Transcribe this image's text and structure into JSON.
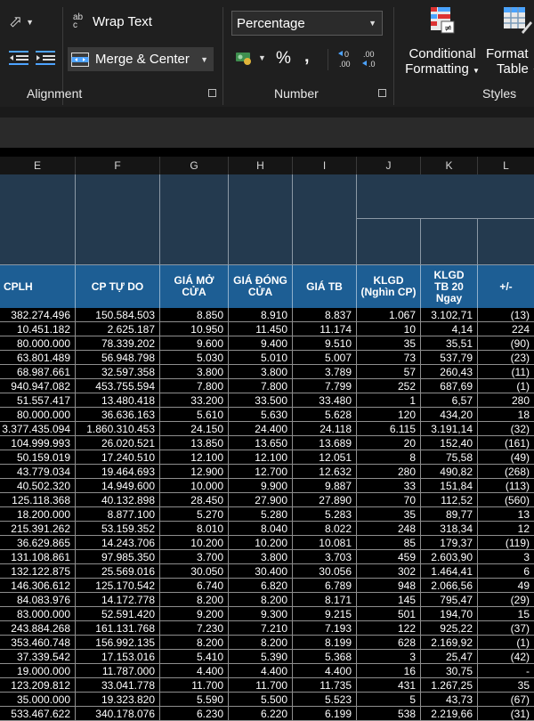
{
  "ribbon": {
    "alignment": {
      "wrap_text": "Wrap Text",
      "merge_center": "Merge & Center",
      "group_label": "Alignment",
      "wrap_icon_text": "ab c"
    },
    "number": {
      "format_value": "Percentage",
      "percent_symbol": "%",
      "comma_symbol": "‚",
      "group_label": "Number"
    },
    "styles": {
      "conditional_formatting_line1": "Conditional",
      "conditional_formatting_line2": "Formatting",
      "format_as_table_line1": "Format",
      "format_as_table_line2": "Table",
      "group_label": "Styles"
    }
  },
  "columns": [
    "E",
    "F",
    "G",
    "H",
    "I",
    "J",
    "K",
    "L"
  ],
  "headers": [
    "CPLH",
    "CP TỰ DO",
    "GIÁ MỞ CỬA",
    "GIÁ ĐÓNG CỬA",
    "GIÁ TB",
    "KLGD (Nghìn CP)",
    "KLGD TB 20 Ngay",
    "+/-"
  ],
  "rows": [
    [
      "382.274.496",
      "150.584.503",
      "8.850",
      "8.910",
      "8.837",
      "1.067",
      "3.102,71",
      "(13)"
    ],
    [
      "10.451.182",
      "2.625.187",
      "10.950",
      "11.450",
      "11.174",
      "10",
      "4,14",
      "224"
    ],
    [
      "80.000.000",
      "78.339.202",
      "9.600",
      "9.400",
      "9.510",
      "35",
      "35,51",
      "(90)"
    ],
    [
      "63.801.489",
      "56.948.798",
      "5.030",
      "5.010",
      "5.007",
      "73",
      "537,79",
      "(23)"
    ],
    [
      "68.987.661",
      "32.597.358",
      "3.800",
      "3.800",
      "3.789",
      "57",
      "260,43",
      "(11)"
    ],
    [
      "940.947.082",
      "453.755.594",
      "7.800",
      "7.800",
      "7.799",
      "252",
      "687,69",
      "(1)"
    ],
    [
      "51.557.417",
      "13.480.418",
      "33.200",
      "33.500",
      "33.480",
      "1",
      "6,57",
      "280"
    ],
    [
      "80.000.000",
      "36.636.163",
      "5.610",
      "5.630",
      "5.628",
      "120",
      "434,20",
      "18"
    ],
    [
      "3.377.435.094",
      "1.860.310.453",
      "24.150",
      "24.400",
      "24.118",
      "6.115",
      "3.191,14",
      "(32)"
    ],
    [
      "104.999.993",
      "26.020.521",
      "13.850",
      "13.650",
      "13.689",
      "20",
      "152,40",
      "(161)"
    ],
    [
      "50.159.019",
      "17.240.510",
      "12.100",
      "12.100",
      "12.051",
      "8",
      "75,58",
      "(49)"
    ],
    [
      "43.779.034",
      "19.464.693",
      "12.900",
      "12.700",
      "12.632",
      "280",
      "490,82",
      "(268)"
    ],
    [
      "40.502.320",
      "14.949.600",
      "10.000",
      "9.900",
      "9.887",
      "33",
      "151,84",
      "(113)"
    ],
    [
      "125.118.368",
      "40.132.898",
      "28.450",
      "27.900",
      "27.890",
      "70",
      "112,52",
      "(560)"
    ],
    [
      "18.200.000",
      "8.877.100",
      "5.270",
      "5.280",
      "5.283",
      "35",
      "89,77",
      "13"
    ],
    [
      "215.391.262",
      "53.159.352",
      "8.010",
      "8.040",
      "8.022",
      "248",
      "318,34",
      "12"
    ],
    [
      "36.629.865",
      "14.243.706",
      "10.200",
      "10.200",
      "10.081",
      "85",
      "179,37",
      "(119)"
    ],
    [
      "131.108.861",
      "97.985.350",
      "3.700",
      "3.800",
      "3.703",
      "459",
      "2.603,90",
      "3"
    ],
    [
      "132.122.875",
      "25.569.016",
      "30.050",
      "30.400",
      "30.056",
      "302",
      "1.464,41",
      "6"
    ],
    [
      "146.306.612",
      "125.170.542",
      "6.740",
      "6.820",
      "6.789",
      "948",
      "2.066,56",
      "49"
    ],
    [
      "84.083.976",
      "14.172.778",
      "8.200",
      "8.200",
      "8.171",
      "145",
      "795,47",
      "(29)"
    ],
    [
      "83.000.000",
      "52.591.420",
      "9.200",
      "9.300",
      "9.215",
      "501",
      "194,70",
      "15"
    ],
    [
      "243.884.268",
      "161.131.768",
      "7.230",
      "7.210",
      "7.193",
      "122",
      "925,22",
      "(37)"
    ],
    [
      "353.460.748",
      "156.992.135",
      "8.200",
      "8.200",
      "8.199",
      "628",
      "2.169,92",
      "(1)"
    ],
    [
      "37.339.542",
      "17.153.016",
      "5.410",
      "5.390",
      "5.368",
      "3",
      "25,47",
      "(42)"
    ],
    [
      "19.000.000",
      "11.787.000",
      "4.400",
      "4.400",
      "4.400",
      "16",
      "30,75",
      "-"
    ],
    [
      "123.209.812",
      "33.041.778",
      "11.700",
      "11.700",
      "11.735",
      "431",
      "1.267,25",
      "35"
    ],
    [
      "35.000.000",
      "19.323.820",
      "5.590",
      "5.500",
      "5.523",
      "5",
      "43,73",
      "(67)"
    ],
    [
      "533.467.622",
      "340.178.076",
      "6.230",
      "6.220",
      "6.199",
      "538",
      "2.219,66",
      "(31)"
    ]
  ],
  "colors": {
    "ribbon_bg": "#1f1f1f",
    "header_fill": "#1d5e94",
    "blank_header_fill": "#243a4f",
    "grid_bg": "#000000"
  }
}
